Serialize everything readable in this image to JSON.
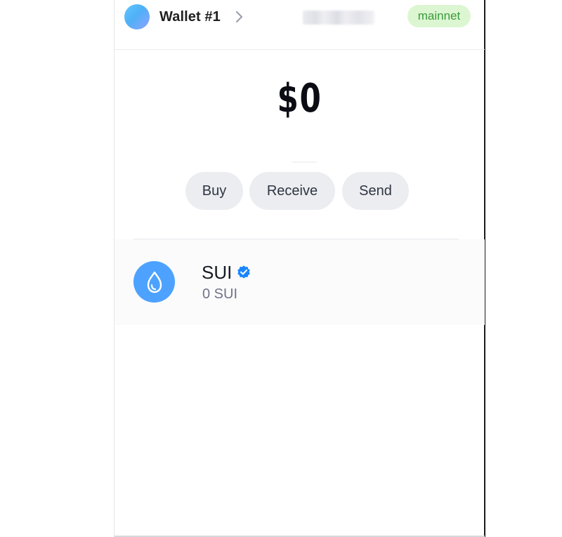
{
  "header": {
    "wallet_name": "Wallet #1",
    "wallet_avatar_icon": "gradient-avatar-icon",
    "chevron_icon": "chevron-right-icon",
    "address": "",
    "network": "mainnet",
    "network_color": "#3a9a3a",
    "network_bg": "#dcf6d2"
  },
  "balance": {
    "value": "$0"
  },
  "actions": {
    "buy_label": "Buy",
    "receive_label": "Receive",
    "send_label": "Send"
  },
  "tokens": [
    {
      "name": "SUI",
      "amount": "0 SUI",
      "icon": "sui-droplet-icon",
      "verified_icon": "verified-badge-icon",
      "accent": "#4da2ff"
    }
  ],
  "colors": {
    "button_bg": "#ebedf0",
    "button_text": "#2f3543",
    "verified": "#1a85ff"
  }
}
